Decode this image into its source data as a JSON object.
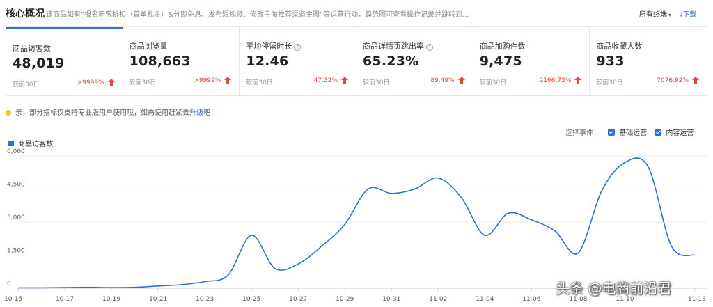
{
  "header": {
    "title": "核心概况",
    "description": "该商品如有“报名新客折扣（首单礼金）&分期免息、发布短视频、修改手淘推荐渠道主图”等运营行动，趋势图可查看操作记录并跳转到...",
    "terminal": "所有终端",
    "download": "下载"
  },
  "cards": [
    {
      "name": "商品访客数",
      "value": "48,019",
      "compare": "较前30日",
      "change": ">9999%",
      "help": false,
      "active": true
    },
    {
      "name": "商品浏览量",
      "value": "108,663",
      "compare": "较前30日",
      "change": ">9999%",
      "help": false,
      "active": false
    },
    {
      "name": "平均停留时长",
      "value": "12.46",
      "compare": "较前30日",
      "change": "47.32%",
      "help": true,
      "active": false
    },
    {
      "name": "商品详情页跳出率",
      "value": "65.23%",
      "compare": "较前30日",
      "change": "89.49%",
      "help": true,
      "active": false
    },
    {
      "name": "商品加购件数",
      "value": "9,475",
      "compare": "较前30日",
      "change": "2166.75%",
      "help": false,
      "active": false
    },
    {
      "name": "商品收藏人数",
      "value": "933",
      "compare": "较前30日",
      "change": "7076.92%",
      "help": false,
      "active": false
    }
  ],
  "notice": {
    "text_before": "亲，部分指标仅支持专业版用户使用哦，如需使用赶紧去",
    "link": "升级",
    "text_after": "吧！"
  },
  "events": {
    "label": "选择事件",
    "options": [
      "基础运营",
      "内容运营"
    ]
  },
  "colors": {
    "accent": "#2f6fd8",
    "up": "#e8443a",
    "notice_dot": "#f3c31b"
  },
  "watermark": "头条 @电商前沿君",
  "chart_data": {
    "type": "line",
    "legend": [
      "商品访客数"
    ],
    "x": [
      "10-15",
      "10-16",
      "10-17",
      "10-18",
      "10-19",
      "10-20",
      "10-21",
      "10-22",
      "10-23",
      "10-24",
      "10-25",
      "10-26",
      "10-27",
      "10-28",
      "10-29",
      "10-30",
      "10-31",
      "11-01",
      "11-02",
      "11-03",
      "11-04",
      "11-05",
      "11-06",
      "11-07",
      "11-08",
      "11-09",
      "11-10",
      "11-11",
      "11-12",
      "11-13"
    ],
    "x_tick_labels": [
      "10-15",
      "10-17",
      "10-19",
      "10-21",
      "10-23",
      "10-25",
      "10-27",
      "10-29",
      "10-31",
      "11-02",
      "11-04",
      "11-06",
      "11-08",
      "11-10",
      "11-13"
    ],
    "series": [
      {
        "name": "商品访客数",
        "values": [
          20,
          20,
          30,
          40,
          30,
          40,
          100,
          160,
          300,
          600,
          2400,
          900,
          1100,
          1900,
          2900,
          4500,
          4300,
          4500,
          5000,
          4100,
          2400,
          3400,
          3100,
          2600,
          1600,
          4400,
          5700,
          5500,
          1900,
          1500
        ]
      }
    ],
    "ylim": [
      0,
      6000
    ],
    "yticks": [
      0,
      1500,
      3000,
      4500,
      6000
    ],
    "ytick_labels": [
      "0",
      "1,500",
      "3,000",
      "4,500",
      "6,000"
    ],
    "grid": true
  }
}
